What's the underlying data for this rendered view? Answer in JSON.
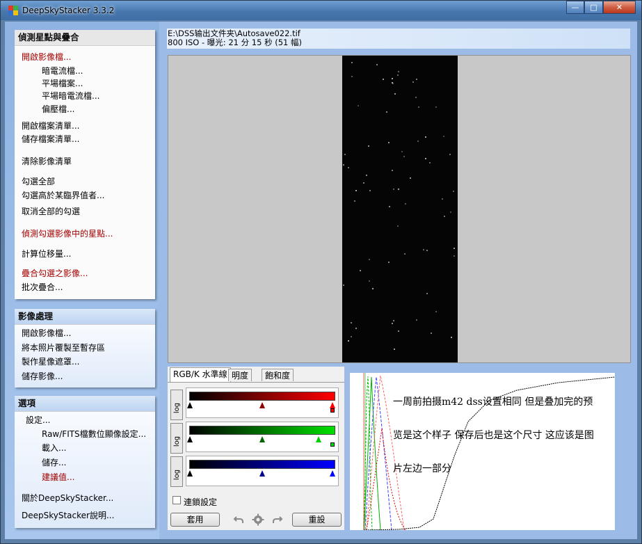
{
  "window": {
    "title": "DeepSkyStacker 3.3.2",
    "minimize": "—",
    "maximize": "□",
    "close": "✕"
  },
  "panel1": {
    "header": "偵測星點與疊合",
    "items": [
      "開啟影像檔...",
      "暗電流檔...",
      "平場檔案...",
      "平場暗電流檔...",
      "偏壓檔...",
      "開啟檔案清單...",
      "儲存檔案清單...",
      "清除影像清單",
      "勾選全部",
      "勾選高於某臨界值者...",
      "取消全部的勾選",
      "偵測勾選影像中的星點...",
      "計算位移量...",
      "疊合勾選之影像...",
      "批次疊合..."
    ]
  },
  "panel2": {
    "header": "影像處理",
    "items": [
      "開啟影像檔...",
      "將本照片覆製至暫存區",
      "製作星像遮罩...",
      "儲存影像..."
    ]
  },
  "panel3": {
    "header": "選項",
    "items": [
      "設定...",
      "Raw/FITS檔數位顯像設定...",
      "載入...",
      "儲存...",
      "建議值...",
      "關於DeepSkyStacker...",
      "DeepSkyStacker說明..."
    ]
  },
  "file": {
    "path": "E:\\DSS输出文件夹\\Autosave022.tif",
    "info": "800 ISO - 曝光: 21 分 15 秒 (51 幅)"
  },
  "tabs": [
    "RGB/K 水準線",
    "明度",
    "飽和度"
  ],
  "log_label": "log",
  "link_settings": "連鎖設定",
  "apply": "套用",
  "reset": "重設",
  "note_lines": [
    "一周前拍摄m42 dss设置相同 但是叠加完的预",
    "览是这个样子 保存后也是这个尺寸 这应该是图",
    "片左边一部分"
  ],
  "colors": {
    "red_link": "#a30000",
    "titlebar": "#4777ad",
    "panel_bg": "#fbfbfb"
  }
}
